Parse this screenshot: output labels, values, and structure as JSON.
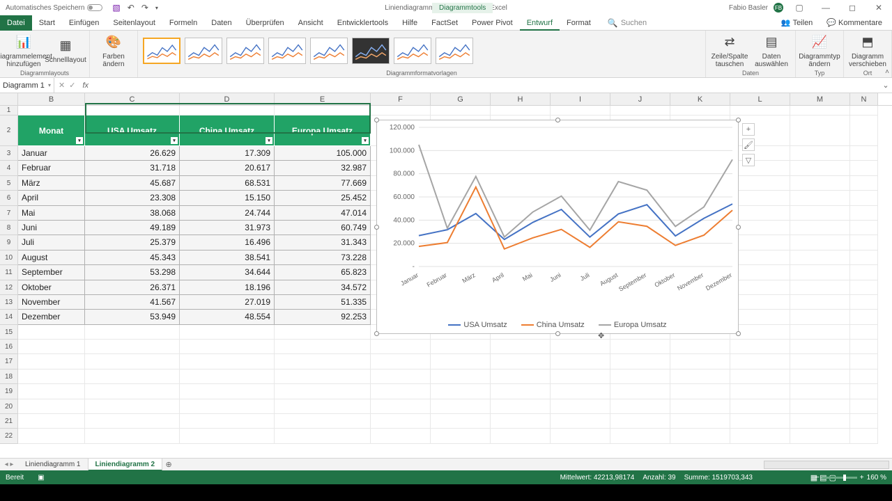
{
  "titlebar": {
    "autosave": "Automatisches Speichern",
    "doc_title": "Liniendiagramm und Trendlinien - Excel",
    "tool_tab": "Diagrammtools",
    "user_name": "Fabio Basler",
    "user_initials": "FB"
  },
  "ribbon_tabs": {
    "file": "Datei",
    "tabs": [
      "Start",
      "Einfügen",
      "Seitenlayout",
      "Formeln",
      "Daten",
      "Überprüfen",
      "Ansicht",
      "Entwicklertools",
      "Hilfe",
      "FactSet",
      "Power Pivot",
      "Entwurf",
      "Format"
    ],
    "active": "Entwurf",
    "search": "Suchen",
    "share": "Teilen",
    "comments": "Kommentare"
  },
  "ribbon": {
    "add_element": "Diagrammelement hinzufügen",
    "quick_layout": "Schnelllayout",
    "colors": "Farben ändern",
    "group_layouts": "Diagrammlayouts",
    "group_styles": "Diagrammformatvorlagen",
    "switch_rc": "Zeile/Spalte tauschen",
    "select_data": "Daten auswählen",
    "group_data": "Daten",
    "change_type": "Diagrammtyp ändern",
    "group_type": "Typ",
    "move_chart": "Diagramm verschieben",
    "group_location": "Ort"
  },
  "namebox": "Diagramm 1",
  "columns": [
    "B",
    "C",
    "D",
    "E",
    "F",
    "G",
    "H",
    "I",
    "J",
    "K",
    "L",
    "M",
    "N"
  ],
  "table": {
    "headers": [
      "Monat",
      "USA Umsatz",
      "China Umsatz",
      "Europa Umsatz"
    ],
    "rows": [
      [
        "Januar",
        "26.629",
        "17.309",
        "105.000"
      ],
      [
        "Februar",
        "31.718",
        "20.617",
        "32.987"
      ],
      [
        "März",
        "45.687",
        "68.531",
        "77.669"
      ],
      [
        "April",
        "23.308",
        "15.150",
        "25.452"
      ],
      [
        "Mai",
        "38.068",
        "24.744",
        "47.014"
      ],
      [
        "Juni",
        "49.189",
        "31.973",
        "60.749"
      ],
      [
        "Juli",
        "25.379",
        "16.496",
        "31.343"
      ],
      [
        "August",
        "45.343",
        "38.541",
        "73.228"
      ],
      [
        "September",
        "53.298",
        "34.644",
        "65.823"
      ],
      [
        "Oktober",
        "26.371",
        "18.196",
        "34.572"
      ],
      [
        "November",
        "41.567",
        "27.019",
        "51.335"
      ],
      [
        "Dezember",
        "53.949",
        "48.554",
        "92.253"
      ]
    ]
  },
  "chart_data": {
    "type": "line",
    "categories": [
      "Januar",
      "Februar",
      "März",
      "April",
      "Mai",
      "Juni",
      "Juli",
      "August",
      "September",
      "Oktober",
      "November",
      "Dezember"
    ],
    "series": [
      {
        "name": "USA Umsatz",
        "color": "#4472c4",
        "values": [
          26629,
          31718,
          45687,
          23308,
          38068,
          49189,
          25379,
          45343,
          53298,
          26371,
          41567,
          53949
        ]
      },
      {
        "name": "China Umsatz",
        "color": "#ed7d31",
        "values": [
          17309,
          20617,
          68531,
          15150,
          24744,
          31973,
          16496,
          38541,
          34644,
          18196,
          27019,
          48554
        ]
      },
      {
        "name": "Europa Umsatz",
        "color": "#a5a5a5",
        "values": [
          105000,
          32987,
          77669,
          25452,
          47014,
          60749,
          31343,
          73228,
          65823,
          34572,
          51335,
          92253
        ]
      }
    ],
    "ylim": [
      0,
      120000
    ],
    "yticks": [
      "-",
      "20.000",
      "40.000",
      "60.000",
      "80.000",
      "100.000",
      "120.000"
    ]
  },
  "sheets": {
    "tabs": [
      "Liniendiagramm 1",
      "Liniendiagramm 2"
    ],
    "active": 1
  },
  "statusbar": {
    "ready": "Bereit",
    "mean_lbl": "Mittelwert:",
    "mean": "42213,98174",
    "count_lbl": "Anzahl:",
    "count": "39",
    "sum_lbl": "Summe:",
    "sum": "1519703,343",
    "zoom": "160 %"
  }
}
